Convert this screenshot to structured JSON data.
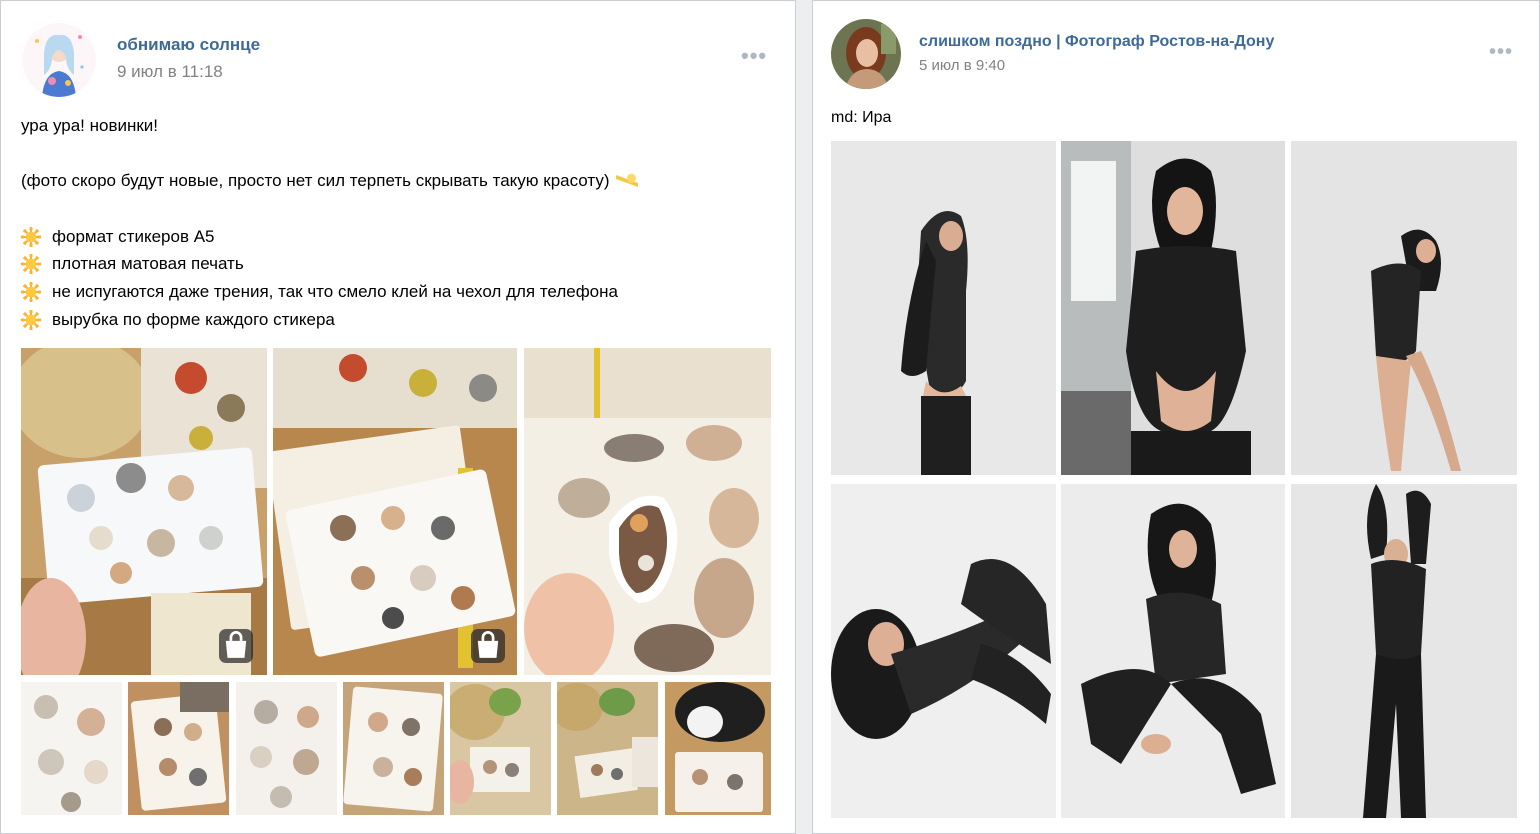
{
  "posts": [
    {
      "author": "обнимаю солнце",
      "date": "9 июл в 11:18",
      "more_icon": "more-horizontal-icon",
      "text": {
        "line1": "ура ура! новинки!",
        "line2": "(фото скоро будут новые, просто нет сил терпеть скрывать такую красоту)",
        "bullets": [
          "формат стикеров А5",
          "плотная матовая печать",
          "не испугаются даже трения, так что смело клей на чехол для телефона",
          "вырубка по форме каждого стикера"
        ]
      },
      "photo_count": 10,
      "shop_badge_icon": "shopping-bag-icon"
    },
    {
      "author": "слишком поздно | Фотограф Ростов-на-Дону",
      "date": "5 июл в 9:40",
      "more_icon": "more-horizontal-icon",
      "text": "md: Ира",
      "photo_count": 6
    }
  ],
  "colors": {
    "author_link": "#3d6a98",
    "date": "#828282",
    "page_bg": "#edeef0",
    "card_border": "#c9ccd1"
  }
}
